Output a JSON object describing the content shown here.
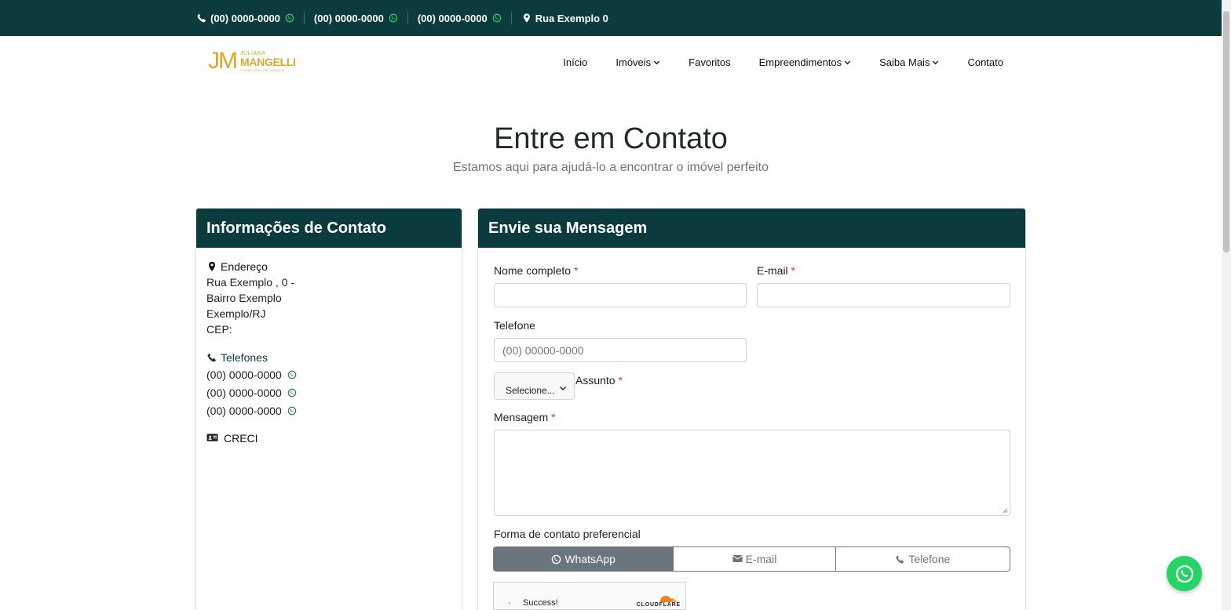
{
  "topbar": {
    "phones": [
      "(00) 0000-0000",
      "(00) 0000-0000",
      "(00) 0000-0000"
    ],
    "address": "Rua Exemplo 0",
    "icons": {
      "phone": "phone-icon",
      "whatsapp": "whatsapp-icon",
      "pin": "map-pin-icon"
    }
  },
  "logo": {
    "initials": "JM",
    "first_name": "JULIANA",
    "last_name": "MANGELLI",
    "tagline": "CORRETORA DE IMÓVEIS"
  },
  "nav": {
    "items": [
      {
        "label": "Início",
        "dropdown": false
      },
      {
        "label": "Imóveis",
        "dropdown": true
      },
      {
        "label": "Favoritos",
        "dropdown": false
      },
      {
        "label": "Empreendimentos",
        "dropdown": true
      },
      {
        "label": "Saiba Mais",
        "dropdown": true
      },
      {
        "label": "Contato",
        "dropdown": false
      }
    ]
  },
  "hero": {
    "title": "Entre em Contato",
    "subtitle": "Estamos aqui para ajudá-lo a encontrar o imóvel perfeito"
  },
  "info": {
    "title": "Informações de Contato",
    "address_label": "Endereço",
    "address_lines": [
      "Rua Exemplo , 0 -",
      "Bairro Exemplo",
      "Exemplo/RJ",
      "CEP:"
    ],
    "phones_label": "Telefones",
    "phones": [
      "(00) 0000-0000",
      "(00) 0000-0000",
      "(00) 0000-0000"
    ],
    "creci_label": "CRECI"
  },
  "form": {
    "title": "Envie sua Mensagem",
    "name_label": "Nome completo",
    "email_label": "E-mail",
    "phone_label": "Telefone",
    "phone_placeholder": "(00) 00000-0000",
    "subject_select": "Selecione...",
    "subject_label": "Assunto",
    "message_label": "Mensagem",
    "required_mark": "*",
    "pref_label": "Forma de contato preferencial",
    "pref_options": [
      "WhatsApp",
      "E-mail",
      "Telefone"
    ],
    "pref_selected": "WhatsApp"
  },
  "captcha": {
    "status": "Success!",
    "brand": "CLOUDFLARE"
  },
  "colors": {
    "brand_dark": "#0b3b3c",
    "logo_gold": "#d8a92a",
    "whatsapp_green": "#25d366",
    "required_red": "#dc3545",
    "selected_gray": "#6c757d"
  }
}
